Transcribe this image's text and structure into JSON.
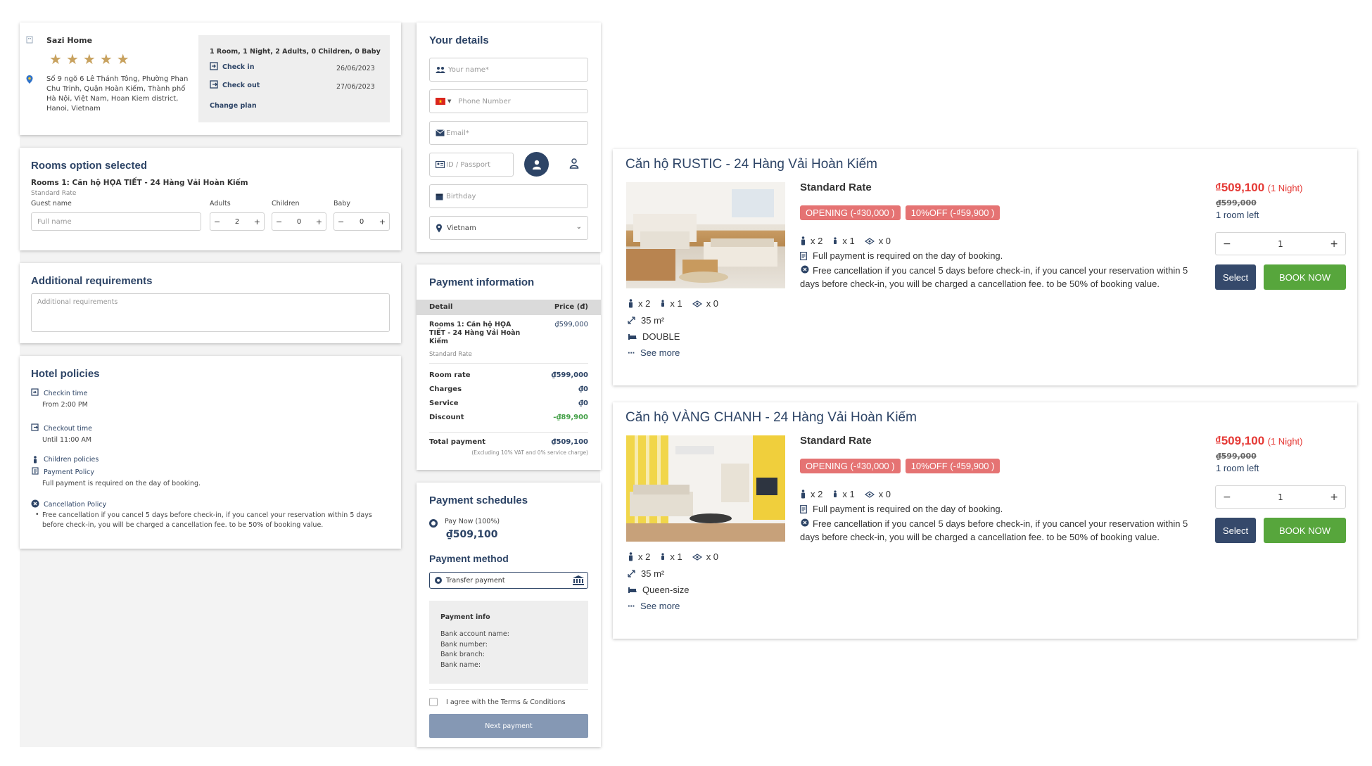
{
  "hotel": {
    "name": "Sazi Home",
    "stars": 5,
    "address": "Số 9 ngõ 6 Lê Thánh Tông, Phường Phan Chu Trinh, Quận Hoàn Kiếm, Thành phố Hà Nội, Việt Nam, Hoan Kiem district, Hanoi, Vietnam",
    "plan_summary": "1 Room, 1 Night, 2 Adults, 0 Children, 0 Baby",
    "checkin_label": "Check in",
    "checkin_date": "26/06/2023",
    "checkout_label": "Check out",
    "checkout_date": "27/06/2023",
    "change_plan": "Change plan"
  },
  "rooms_selected": {
    "title": "Rooms option selected",
    "room_name": "Rooms 1: Căn hộ HỌA TIẾT - 24 Hàng Vải Hoàn Kiếm",
    "rate": "Standard Rate",
    "guest_label": "Guest name",
    "guest_placeholder": "Full name",
    "adults_label": "Adults",
    "adults": "2",
    "children_label": "Children",
    "children": "0",
    "baby_label": "Baby",
    "baby": "0"
  },
  "additional": {
    "title": "Additional requirements",
    "placeholder": "Additional requirements"
  },
  "policies": {
    "title": "Hotel policies",
    "checkin_title": "Checkin time",
    "checkin_value": "From 2:00 PM",
    "checkout_title": "Checkout time",
    "checkout_value": "Until 11:00 AM",
    "children_title": "Children policies",
    "payment_title": "Payment Policy",
    "payment_value": "Full payment is required on the day of booking.",
    "cancel_title": "Cancellation Policy",
    "cancel_value": "Free cancellation if you cancel 5 days before check-in, if you cancel your reservation within 5 days before check-in, you will be charged a cancellation fee. to be 50% of booking value."
  },
  "details": {
    "title": "Your details",
    "name_placeholder": "Your name*",
    "phone_placeholder": "Phone Number",
    "email_placeholder": "Email*",
    "id_placeholder": "ID / Passport",
    "birthday_placeholder": "Birthday",
    "country": "Vietnam"
  },
  "payment_info": {
    "title": "Payment information",
    "col_detail": "Detail",
    "col_price": "Price (đ)",
    "room_line": "Rooms 1: Căn hộ HỌA TIẾT - 24 Hàng Vải Hoàn Kiếm",
    "room_rate_name": "Standard Rate",
    "room_line_price": "₫599,000",
    "room_rate_label": "Room rate",
    "room_rate_value": "₫599,000",
    "charges_label": "Charges",
    "charges_value": "₫0",
    "service_label": "Service",
    "service_value": "₫0",
    "discount_label": "Discount",
    "discount_value": "-₫89,900",
    "total_label": "Total payment",
    "total_value": "₫509,100",
    "total_note": "(Excluding 10% VAT and 0% service charge)"
  },
  "schedules": {
    "title": "Payment schedules",
    "pay_now": "Pay Now (100%)",
    "pay_now_amount": "₫509,100",
    "method_title": "Payment method",
    "method": "Transfer payment",
    "info_title": "Payment info",
    "bank_account": "Bank account name:",
    "bank_number": "Bank number:",
    "bank_branch": "Bank branch:",
    "bank_name": "Bank name:",
    "agree": "I agree with the Terms & Conditions",
    "next": "Next payment"
  },
  "room_cards": [
    {
      "title": "Căn hộ RUSTIC - 24 Hàng Vải Hoàn Kiếm",
      "rate": "Standard Rate",
      "promo1": "OPENING (-₫30,000 )",
      "promo2": "10%OFF (-₫59,900 )",
      "adults": "x 2",
      "children": "x 1",
      "views": "x 0",
      "full_payment": "Full payment is required on the day of booking.",
      "cancellation": "Free cancellation if you cancel 5 days before check-in, if you cancel your reservation within 5 days before check-in, you will be charged a cancellation fee. to be 50% of booking value.",
      "area": "35 m²",
      "bed": "DOUBLE",
      "see_more": "See more",
      "price": "₫509,100",
      "nights": "(1 Night)",
      "old_price": "₫599,000",
      "rooms_left": "1 room left",
      "qty": "1",
      "select": "Select",
      "book": "BOOK NOW"
    },
    {
      "title": "Căn hộ VÀNG CHANH - 24 Hàng Vải Hoàn Kiếm",
      "rate": "Standard Rate",
      "promo1": "OPENING (-₫30,000 )",
      "promo2": "10%OFF (-₫59,900 )",
      "adults": "x 2",
      "children": "x 1",
      "views": "x 0",
      "full_payment": "Full payment is required on the day of booking.",
      "cancellation": "Free cancellation if you cancel 5 days before check-in, if you cancel your reservation within 5 days before check-in, you will be charged a cancellation fee. to be 50% of booking value.",
      "area": "35 m²",
      "bed": "Queen-size",
      "see_more": "See more",
      "price": "₫509,100",
      "nights": "(1 Night)",
      "old_price": "₫599,000",
      "rooms_left": "1 room left",
      "qty": "1",
      "select": "Select",
      "book": "BOOK NOW"
    }
  ],
  "colors": {
    "navy": "#2d4466",
    "red": "#e53935",
    "green": "#57a63c",
    "star": "#c8a25f"
  }
}
